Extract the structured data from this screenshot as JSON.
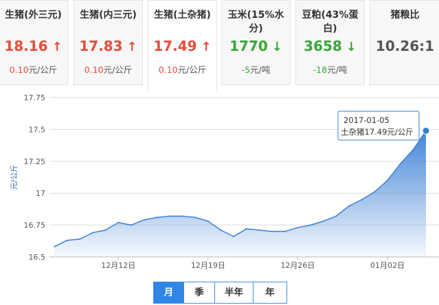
{
  "tabs": [
    {
      "name": "生猪(外三元)",
      "price": "18.16",
      "arrow": "↑",
      "trend": "up",
      "change": "0.10",
      "unit": "元/公斤"
    },
    {
      "name": "生猪(内三元)",
      "price": "17.83",
      "arrow": "↑",
      "trend": "up",
      "change": "0.10",
      "unit": "元/公斤"
    },
    {
      "name": "生猪(土杂猪)",
      "price": "17.49",
      "arrow": "↑",
      "trend": "up",
      "change": "0.10",
      "unit": "元/公斤"
    },
    {
      "name": "玉米(15%水分)",
      "price": "1770",
      "arrow": "↓",
      "trend": "down",
      "change": "-5",
      "unit": "元/吨"
    },
    {
      "name": "豆粕(43%蛋白)",
      "price": "3658",
      "arrow": "↓",
      "trend": "down",
      "change": "-18",
      "unit": "元/吨"
    },
    {
      "name": "猪粮比",
      "price": "10.26:1",
      "arrow": "",
      "trend": "neutral",
      "change": "",
      "unit": ""
    }
  ],
  "active_tab": 2,
  "range_buttons": [
    "月",
    "季",
    "半年",
    "年"
  ],
  "active_range": 0,
  "colors": {
    "line": "#3a7fd5",
    "area_top": "#3a7fd5",
    "up": "#e74c3c",
    "down": "#3aa538"
  },
  "chart_data": {
    "type": "area",
    "ylabel": "元/公斤",
    "ylim": [
      16.5,
      17.75
    ],
    "yticks": [
      "16.5",
      "16.75",
      "17",
      "17.25",
      "17.5",
      "17.75"
    ],
    "xtick_labels": [
      "12月12日",
      "12月19日",
      "12月26日",
      "01月02日"
    ],
    "dates": [
      "2016-12-07",
      "2016-12-08",
      "2016-12-09",
      "2016-12-10",
      "2016-12-11",
      "2016-12-12",
      "2016-12-13",
      "2016-12-14",
      "2016-12-15",
      "2016-12-16",
      "2016-12-17",
      "2016-12-18",
      "2016-12-19",
      "2016-12-20",
      "2016-12-21",
      "2016-12-22",
      "2016-12-23",
      "2016-12-24",
      "2016-12-25",
      "2016-12-26",
      "2016-12-27",
      "2016-12-28",
      "2016-12-29",
      "2016-12-30",
      "2016-12-31",
      "2017-01-01",
      "2017-01-02",
      "2017-01-03",
      "2017-01-04",
      "2017-01-05"
    ],
    "values": [
      16.58,
      16.63,
      16.64,
      16.69,
      16.71,
      16.77,
      16.75,
      16.79,
      16.81,
      16.82,
      16.82,
      16.81,
      16.78,
      16.71,
      16.66,
      16.72,
      16.71,
      16.7,
      16.7,
      16.73,
      16.75,
      16.78,
      16.82,
      16.9,
      16.95,
      17.01,
      17.1,
      17.23,
      17.34,
      17.49
    ],
    "tooltip": {
      "date": "2017-01-05",
      "label": "土杂猪17.49元/公斤"
    }
  }
}
